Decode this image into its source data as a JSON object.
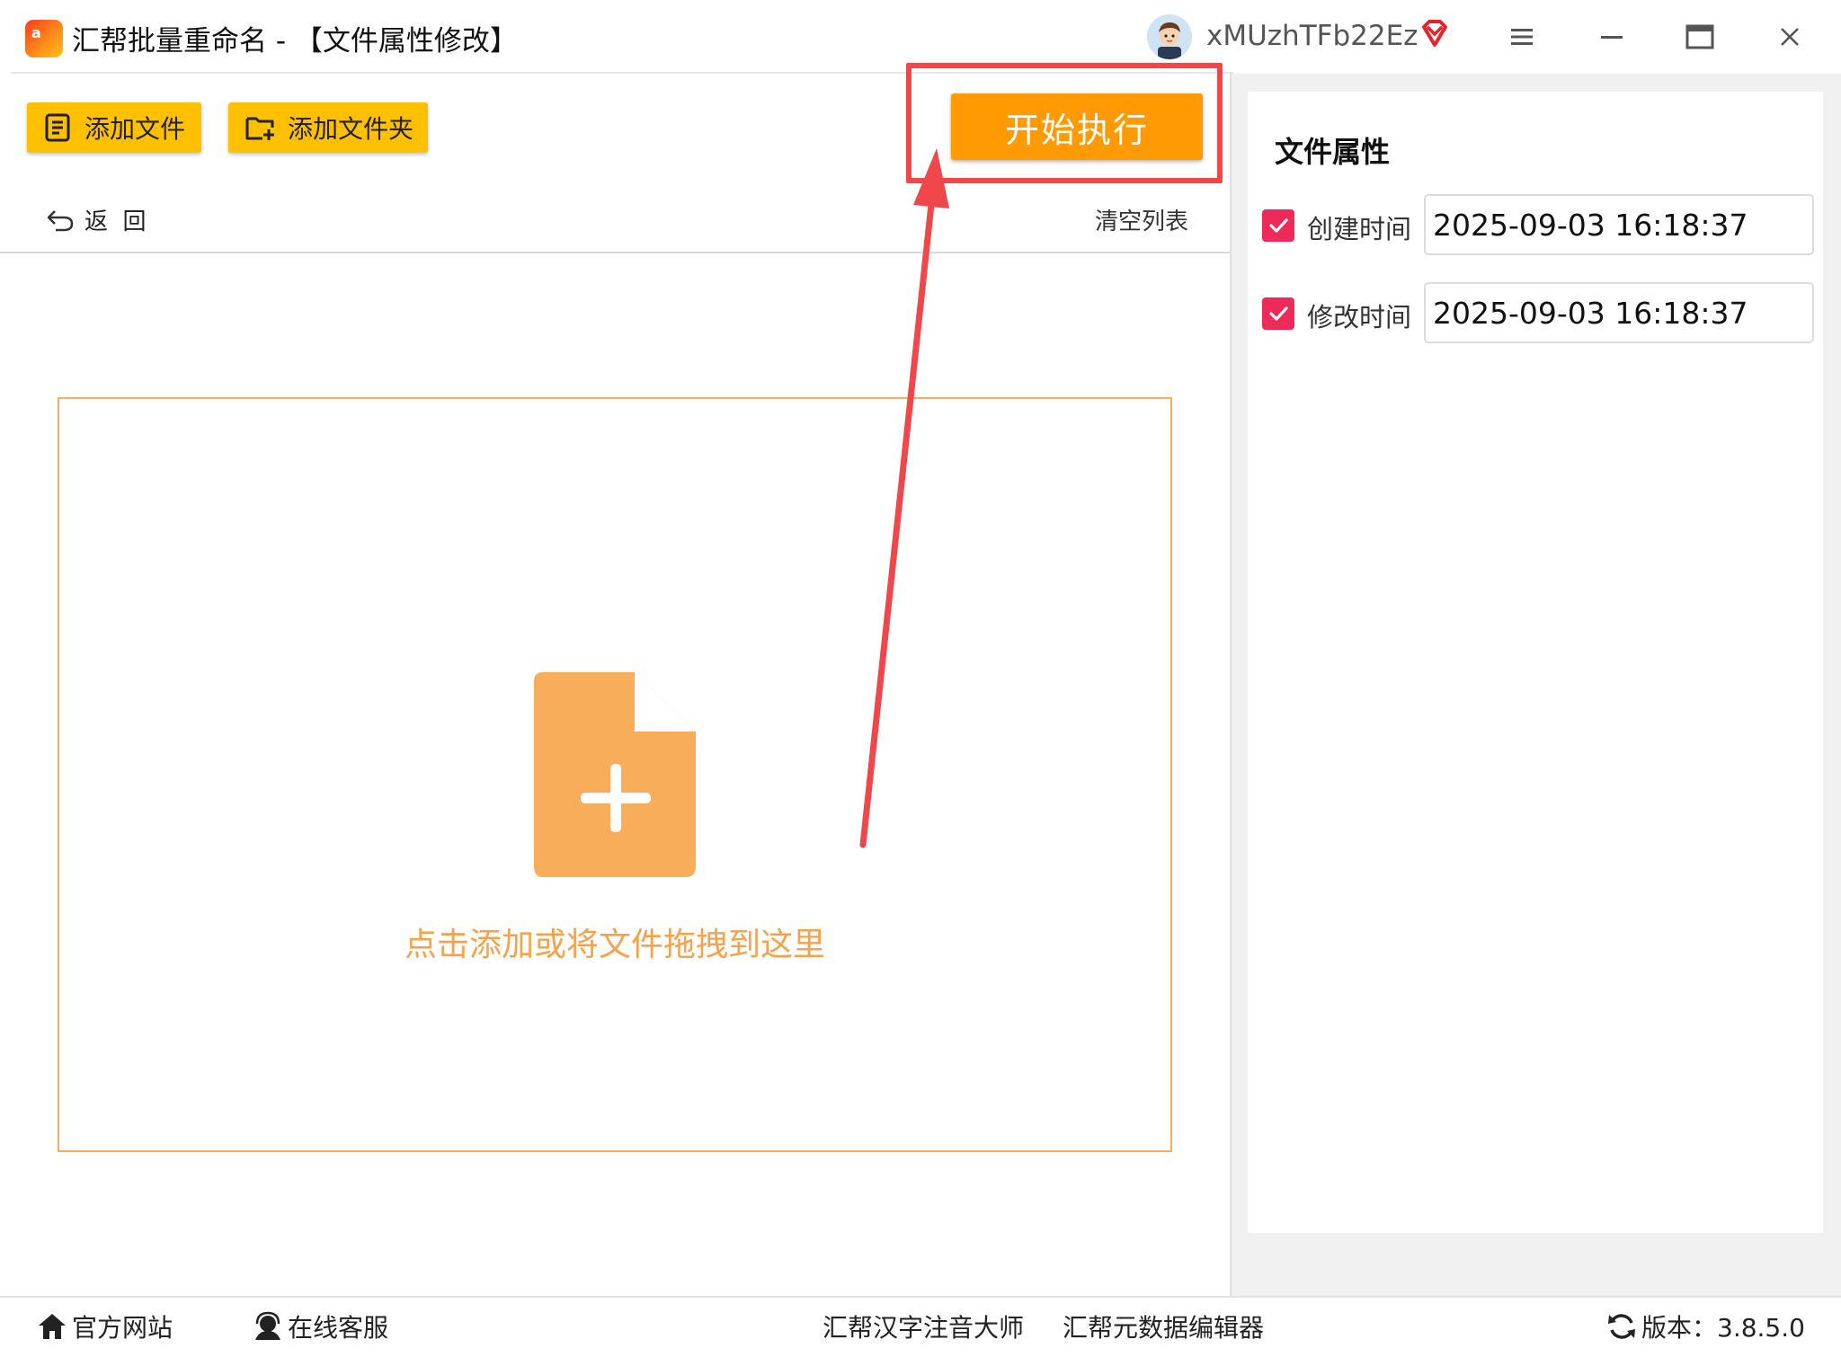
{
  "window": {
    "title": "汇帮批量重命名 - 【文件属性修改】",
    "logo_text": "a",
    "user_name": "xMUzhTFb22Ez"
  },
  "toolbar": {
    "add_file": "添加文件",
    "add_folder": "添加文件夹",
    "start": "开始执行",
    "back": "返  回",
    "clear_list": "清空列表"
  },
  "dropzone": {
    "hint": "点击添加或将文件拖拽到这里"
  },
  "panel": {
    "title": "文件属性",
    "created_label": "创建时间",
    "created_value": "2025-09-03 16:18:37",
    "created_checked": true,
    "modified_label": "修改时间",
    "modified_value": "2025-09-03 16:18:37",
    "modified_checked": true
  },
  "status": {
    "website": "官方网站",
    "support": "在线客服",
    "pinyin_tool": "汇帮汉字注音大师",
    "metadata_tool": "汇帮元数据编辑器",
    "version": "版本：3.8.5.0"
  },
  "colors": {
    "accent_yellow": "#ffc000",
    "start_orange": "#ff9a02",
    "highlight_red": "#f0474b",
    "dropzone_orange": "#f8ad5a",
    "checkbox_pink": "#ee2a5a"
  },
  "icons": [
    "app-logo",
    "vip-diamond-icon",
    "menu-icon",
    "minimize-icon",
    "maximize-icon",
    "close-icon",
    "file-list-icon",
    "folder-add-icon",
    "undo-icon",
    "file-add-icon",
    "home-icon",
    "headset-icon",
    "refresh-icon"
  ]
}
